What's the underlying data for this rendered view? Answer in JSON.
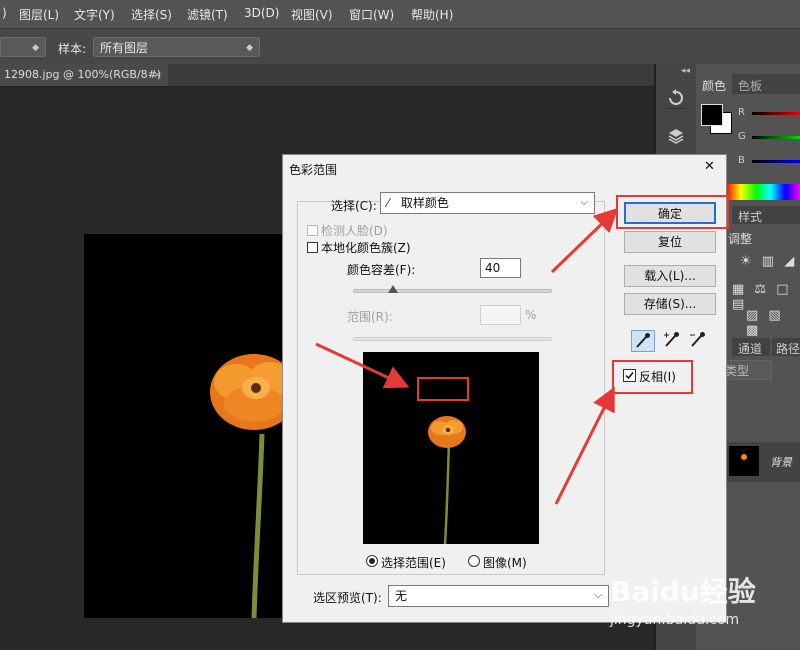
{
  "menu": [
    "图层(L)",
    "文字(Y)",
    "选择(S)",
    "滤镜(T)",
    "3D(D)",
    "视图(V)",
    "窗口(W)",
    "帮助(H)"
  ],
  "options": {
    "sample_label": "样本:",
    "sample_value": "所有图层"
  },
  "document": {
    "tab_title": "12908.jpg @ 100%(RGB/8#)",
    "close": "×"
  },
  "panels": {
    "color_tab": "颜色",
    "swatches_tab": "色板",
    "rgb_labels": [
      "R",
      "G",
      "B"
    ],
    "styles_tab": "样式",
    "adjust_label": "调整",
    "channels_tab": "通道",
    "paths_tab": "路径",
    "type_label": "类型",
    "layer_name": "背景",
    "collapse": "◂◂"
  },
  "dialog": {
    "title": "色彩范围",
    "close": "✕",
    "select_label": "选择(C):",
    "select_value": "取样颜色",
    "detect_faces": "检测人脸(D)",
    "localized": "本地化颜色簇(Z)",
    "fuzziness_label": "颜色容差(F):",
    "fuzziness_value": "40",
    "range_label": "范围(R):",
    "range_unit": "%",
    "radio_selection": "选择范围(E)",
    "radio_image": "图像(M)",
    "preview_label": "选区预览(T):",
    "preview_value": "无",
    "ok": "确定",
    "reset": "复位",
    "load": "载入(L)...",
    "save": "存储(S)...",
    "invert": "反相(I)",
    "invert_checked": true,
    "fuzziness_fraction": 0.2
  },
  "watermark": {
    "brand": "Baidu经验",
    "url": "jingyan.baidu.com"
  },
  "colors": {
    "annotation": "#e53935",
    "canvas": "#000000",
    "flower": "#f08a1c"
  }
}
